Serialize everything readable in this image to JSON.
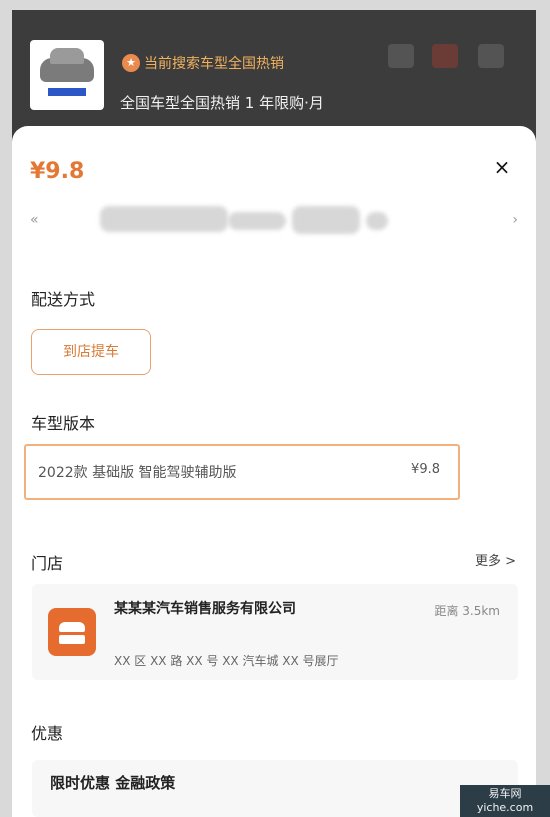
{
  "top": {
    "hot_text": "当前搜索车型全国热销",
    "description": "全国车型全国热销 1 年限购·月"
  },
  "sheet": {
    "price": "¥9.8",
    "close_label": "×"
  },
  "sections": {
    "delivery_title": "配送方式",
    "delivery_option": "到店提车",
    "version_title": "车型版本",
    "version_name": "2022款 基础版 智能驾驶辅助版",
    "version_price": "¥9.8",
    "store_title": "门店",
    "store_more": "更多 >",
    "store_name": "某某某汽车销售服务有限公司",
    "store_distance": "距离 3.5km",
    "store_address": "XX 区 XX 路 XX 号 XX 汽车城 XX 号展厅",
    "deals_title": "优惠",
    "deal_text": "限时优惠 金融政策"
  },
  "watermark": "易车网 yiche.com"
}
